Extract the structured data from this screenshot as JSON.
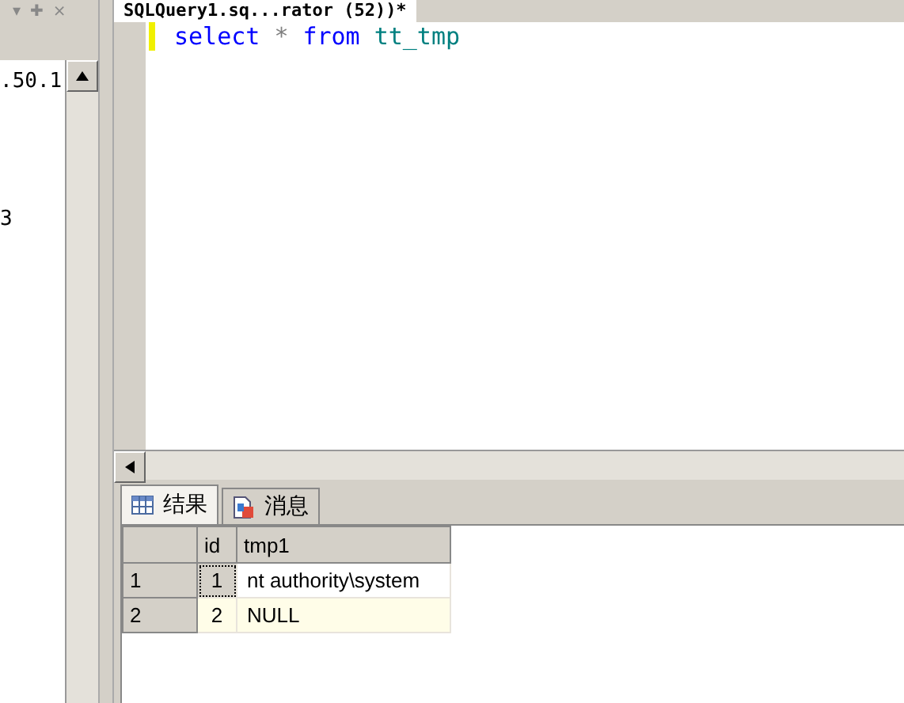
{
  "explorer": {
    "header_buttons": [
      "▾",
      "✚",
      "×"
    ],
    "items": [
      ".50.1",
      "3"
    ]
  },
  "query_tab": {
    "title": "SQLQuery1.sq...rator (52))*"
  },
  "editor": {
    "tokens": [
      {
        "text": "select",
        "kind": "keyword"
      },
      {
        "text": "*",
        "kind": "operator"
      },
      {
        "text": "from",
        "kind": "keyword"
      },
      {
        "text": "tt_tmp",
        "kind": "identifier"
      }
    ]
  },
  "result_tabs": [
    {
      "label": "结果",
      "selected": true
    },
    {
      "label": "消息",
      "selected": false
    }
  ],
  "table": {
    "columns": [
      "id",
      "tmp1"
    ],
    "rows": [
      {
        "row_number": "1",
        "cells": [
          "1",
          "nt authority\\system"
        ],
        "selected": true
      },
      {
        "row_number": "2",
        "cells": [
          "2",
          "NULL"
        ],
        "selected": false
      }
    ]
  }
}
